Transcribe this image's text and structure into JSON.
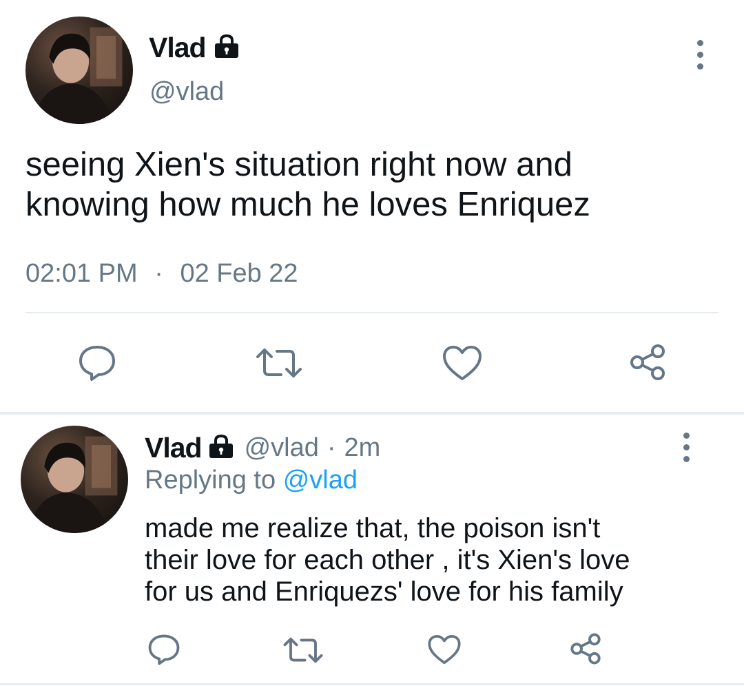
{
  "tweet": {
    "display_name": "Vlad",
    "handle": "@vlad",
    "text_line1": "seeing Xien's situation right now and",
    "text_line2": "knowing how much he loves Enriquez",
    "time": "02:01 PM",
    "separator": "·",
    "date": "02 Feb 22"
  },
  "reply": {
    "display_name": "Vlad",
    "handle": "@vlad",
    "separator": "·",
    "age": "2m",
    "replying_prefix": "Replying to",
    "replying_to": "@vlad",
    "text_line1": "made me realize that, the poison isn't",
    "text_line2": "their love for each other , it's Xien's love",
    "text_line3": "for us and Enriquezs' love for his family"
  },
  "icons": {
    "lock": "lock-icon",
    "more": "more-vertical-icon",
    "reply": "reply-icon",
    "retweet": "retweet-icon",
    "like": "heart-icon",
    "share": "share-icon"
  },
  "colors": {
    "text": "#0f1419",
    "muted": "#657786",
    "link": "#1da1f2",
    "divider": "#e6ecf0"
  }
}
